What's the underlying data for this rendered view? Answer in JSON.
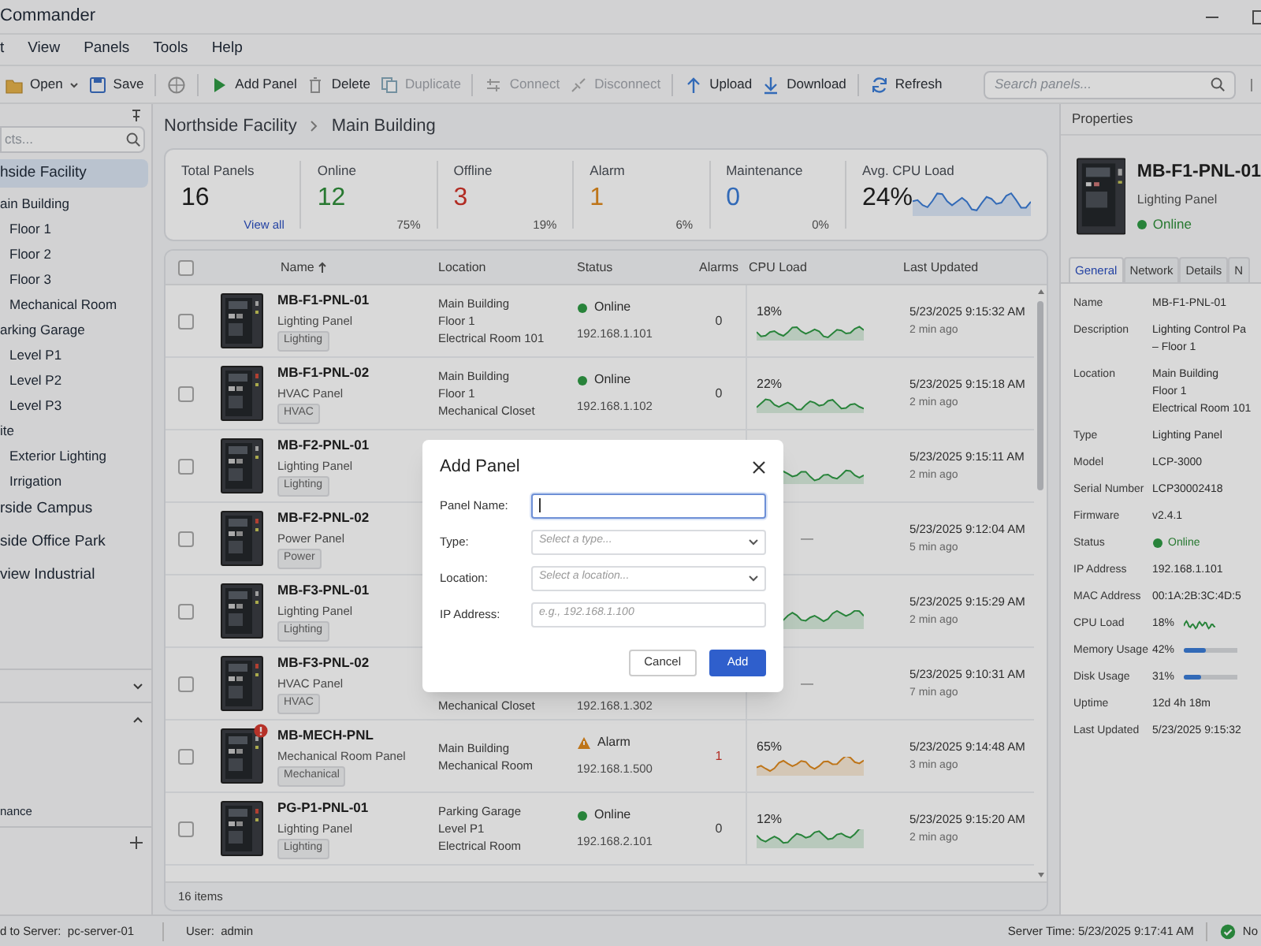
{
  "window": {
    "title": "Commander"
  },
  "menu": [
    "t",
    "View",
    "Panels",
    "Tools",
    "Help"
  ],
  "toolbar": [
    {
      "kind": "folder",
      "label": "Open",
      "caret": true,
      "disabled": false
    },
    {
      "kind": "save",
      "label": "Save",
      "disabled": false
    },
    {
      "kind": "globe"
    },
    {
      "kind": "play",
      "label": "Add Panel",
      "disabled": false
    },
    {
      "kind": "trash",
      "label": "Delete",
      "disabled": false
    },
    {
      "kind": "copy",
      "label": "Duplicate",
      "disabled": true
    },
    {
      "kind": "plug",
      "label": "Connect",
      "disabled": true
    },
    {
      "kind": "unplug",
      "label": "Disconnect",
      "disabled": true
    },
    {
      "kind": "up",
      "label": "Upload",
      "disabled": false
    },
    {
      "kind": "down",
      "label": "Download",
      "disabled": false
    },
    {
      "kind": "refresh",
      "label": "Refresh",
      "disabled": false
    }
  ],
  "search": {
    "placeholder": "Search panels..."
  },
  "sidebar": {
    "search_placeholder": "cts...",
    "tree": [
      {
        "label": "hside Facility",
        "selected": true,
        "children": [
          {
            "label": "ain Building",
            "selected": false,
            "children": [
              {
                "label": "Floor 1",
                "selected": false
              },
              {
                "label": "Floor 2",
                "selected": false
              },
              {
                "label": "Floor 3",
                "selected": false
              },
              {
                "label": "Mechanical Room",
                "selected": false
              }
            ]
          },
          {
            "label": "arking Garage",
            "selected": false,
            "children": [
              {
                "label": "Level P1",
                "selected": false
              },
              {
                "label": "Level P2",
                "selected": false
              },
              {
                "label": "Level P3",
                "selected": false
              }
            ]
          },
          {
            "label": "ite",
            "selected": false,
            "children": [
              {
                "label": "Exterior Lighting",
                "selected": false
              },
              {
                "label": "Irrigation",
                "selected": false
              }
            ]
          }
        ]
      },
      {
        "label": "rside Campus",
        "selected": false
      },
      {
        "label": "side Office Park",
        "selected": false
      },
      {
        "label": "view Industrial",
        "selected": false
      }
    ],
    "sections": [
      {
        "expanded": false
      },
      {
        "expanded": true,
        "items": [
          "nance"
        ],
        "add": true
      }
    ]
  },
  "breadcrumb": [
    "Northside Facility",
    "Main Building"
  ],
  "stats": [
    {
      "label": "Total Panels",
      "value": "16",
      "kind": "neutral",
      "link": "View all"
    },
    {
      "label": "Online",
      "value": "12",
      "kind": "good",
      "percent": "75%"
    },
    {
      "label": "Offline",
      "value": "3",
      "kind": "bad",
      "percent": "19%"
    },
    {
      "label": "Alarm",
      "value": "1",
      "kind": "warn",
      "percent": "6%"
    },
    {
      "label": "Maintenance",
      "value": "0",
      "kind": "info",
      "percent": "0%"
    },
    {
      "label": "Avg. CPU Load",
      "value": "24%",
      "kind": "neutral",
      "trend": true
    }
  ],
  "table": {
    "columns": [
      "Name",
      "Location",
      "Status",
      "Alarms",
      "CPU Load",
      "Last Updated"
    ],
    "sorted_ascending": true,
    "all_selected": false,
    "rows": [
      {
        "selected": false,
        "name": "MB-F1-PNL-01",
        "type": "Lighting Panel",
        "tag": "Lighting",
        "alert": false,
        "location": [
          "Main Building",
          "Floor 1",
          "Electrical Room 101"
        ],
        "status": {
          "kind": "online",
          "label": "Online"
        },
        "ip": "192.168.1.101",
        "alarms": "0",
        "cpu": "18%",
        "kind": "normal",
        "updated": "5/23/2025 9:15:32 AM",
        "ago": "2 min ago"
      },
      {
        "selected": false,
        "name": "MB-F1-PNL-02",
        "type": "HVAC Panel",
        "tag": "HVAC",
        "alert": false,
        "location": [
          "Main Building",
          "Floor 1",
          "Mechanical Closet"
        ],
        "status": {
          "kind": "online",
          "label": "Online"
        },
        "ip": "192.168.1.102",
        "alarms": "0",
        "cpu": "22%",
        "kind": "normal",
        "updated": "5/23/2025 9:15:18 AM",
        "ago": "2 min ago"
      },
      {
        "selected": false,
        "name": "MB-F2-PNL-01",
        "type": "Lighting Panel",
        "tag": "Lighting",
        "alert": false,
        "kind": "normal",
        "updated": "5/23/2025 9:15:11 AM",
        "ago": "2 min ago"
      },
      {
        "selected": false,
        "name": "MB-F2-PNL-02",
        "type": "Power Panel",
        "tag": "Power",
        "alert": false,
        "cpu": "—",
        "kind": "none",
        "updated": "5/23/2025 9:12:04 AM",
        "ago": "5 min ago"
      },
      {
        "selected": false,
        "name": "MB-F3-PNL-01",
        "type": "Lighting Panel",
        "tag": "Lighting",
        "alert": false,
        "kind": "normal",
        "updated": "5/23/2025 9:15:29 AM",
        "ago": "2 min ago"
      },
      {
        "selected": false,
        "name": "MB-F3-PNL-02",
        "type": "HVAC Panel",
        "tag": "HVAC",
        "alert": false,
        "location": [
          "Mechanical Closet"
        ],
        "ip": "192.168.1.302",
        "cpu": "—",
        "kind": "none",
        "updated": "5/23/2025 9:10:31 AM",
        "ago": "7 min ago"
      },
      {
        "selected": false,
        "name": "MB-MECH-PNL",
        "type": "Mechanical Room Panel",
        "tag": "Mechanical",
        "alert": true,
        "location": [
          "Main Building",
          "Mechanical Room"
        ],
        "status": {
          "kind": "alarm",
          "label": "Alarm"
        },
        "ip": "192.168.1.500",
        "alarms": "1",
        "cpu": "65%",
        "kind": "high",
        "updated": "5/23/2025 9:14:48 AM",
        "ago": "3 min ago"
      },
      {
        "selected": false,
        "name": "PG-P1-PNL-01",
        "type": "Lighting Panel",
        "tag": "Lighting",
        "alert": false,
        "location": [
          "Parking Garage",
          "Level P1",
          "Electrical Room"
        ],
        "status": {
          "kind": "online",
          "label": "Online"
        },
        "ip": "192.168.2.101",
        "alarms": "0",
        "cpu": "12%",
        "kind": "normal",
        "updated": "5/23/2025 9:15:20 AM",
        "ago": "2 min ago"
      }
    ],
    "footer": "16 items"
  },
  "properties": {
    "title": "Properties",
    "name": "MB-F1-PNL-01",
    "type": "Lighting Panel",
    "status": {
      "kind": "online",
      "label": "Online"
    },
    "tabs": [
      {
        "label": "General",
        "selected": true
      },
      {
        "label": "Network",
        "selected": false
      },
      {
        "label": "Details",
        "selected": false
      },
      {
        "label": "N",
        "selected": false
      }
    ],
    "fields": [
      {
        "kind": "text",
        "label": "Name",
        "value": [
          "MB-F1-PNL-01"
        ]
      },
      {
        "kind": "text",
        "label": "Description",
        "value": [
          "Lighting Control Pa",
          "– Floor 1"
        ]
      },
      {
        "kind": "text",
        "label": "Location",
        "value": [
          "Main Building",
          "Floor 1",
          "Electrical Room 101"
        ]
      },
      {
        "kind": "text",
        "label": "Type",
        "value": [
          "Lighting Panel"
        ]
      },
      {
        "kind": "text",
        "label": "Model",
        "value": [
          "LCP-3000"
        ]
      },
      {
        "kind": "text",
        "label": "Serial Number",
        "value": [
          "LCP30002418"
        ]
      },
      {
        "kind": "text",
        "label": "Firmware",
        "value": [
          "v2.4.1"
        ]
      },
      {
        "kind": "status",
        "label": "Status",
        "value": [
          "Online"
        ]
      },
      {
        "kind": "text",
        "label": "IP Address",
        "value": [
          "192.168.1.101"
        ]
      },
      {
        "kind": "text",
        "label": "MAC Address",
        "value": [
          "00:1A:2B:3C:4D:5"
        ]
      },
      {
        "kind": "trend",
        "label": "CPU Load",
        "value": [
          "18%"
        ]
      },
      {
        "kind": "bar",
        "label": "Memory Usage",
        "value": [
          "42%"
        ],
        "level": 0.42
      },
      {
        "kind": "bar",
        "label": "Disk Usage",
        "value": [
          "31%"
        ],
        "level": 0.31
      },
      {
        "kind": "text",
        "label": "Uptime",
        "value": [
          "12d 4h 18m"
        ]
      },
      {
        "kind": "text",
        "label": "Last Updated",
        "value": [
          "5/23/2025 9:15:32"
        ]
      }
    ]
  },
  "status_bar": {
    "server": "d to Server:  pc-server-01",
    "user": "User:  admin",
    "time": "Server Time: 5/23/2025 9:17:41 AM",
    "connected": true,
    "note": "No"
  },
  "dialog": {
    "title": "Add Panel",
    "fields": [
      {
        "label": "Panel Name:",
        "kind": "input",
        "focused": true
      },
      {
        "label": "Type:",
        "kind": "select",
        "placeholder": "Select a type..."
      },
      {
        "label": "Location:",
        "kind": "select",
        "placeholder": "Select a location..."
      },
      {
        "label": "IP Address:",
        "kind": "input",
        "placeholder": "e.g., 192.168.1.100",
        "focused": false
      }
    ],
    "buttons": [
      {
        "label": "Cancel",
        "kind": "secondary"
      },
      {
        "label": "Add",
        "kind": "primary"
      }
    ]
  }
}
